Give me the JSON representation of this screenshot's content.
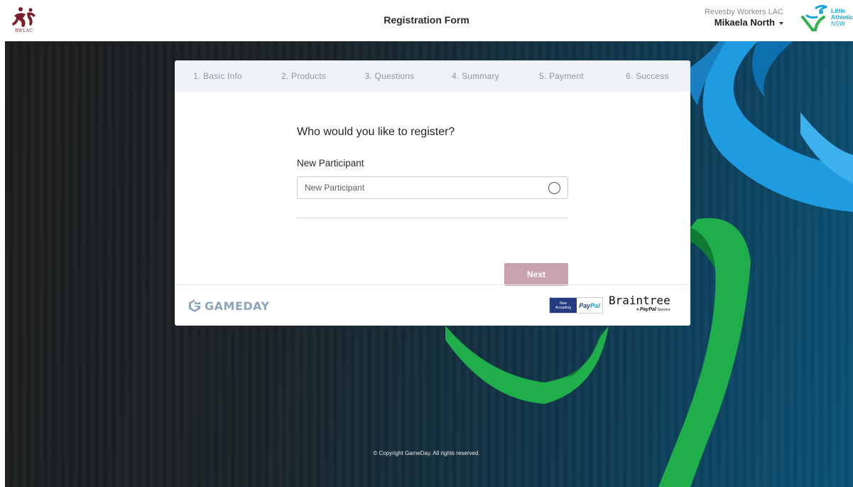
{
  "header": {
    "club_logo_text": "RWLAC",
    "title": "Registration Form",
    "org_name": "Revesby Workers LAC",
    "user_name": "Mikaela North",
    "partner_logo": {
      "line1": "Little",
      "line2": "Athletics",
      "line3": "NSW"
    }
  },
  "steps": [
    {
      "label": "1. Basic Info"
    },
    {
      "label": "2. Products"
    },
    {
      "label": "3. Questions"
    },
    {
      "label": "4. Summary"
    },
    {
      "label": "5. Payment"
    },
    {
      "label": "6. Success"
    }
  ],
  "form": {
    "question": "Who would you like to register?",
    "field_label": "New Participant",
    "select_value": "New Participant",
    "next_label": "Next"
  },
  "footer": {
    "gameday_text": "GAMEDAY",
    "paypal_now": "Now",
    "paypal_accepting": "Accepting",
    "paypal_pay": "Pay",
    "paypal_pal": "Pal",
    "braintree_name": "Braintree",
    "braintree_sub_a": "A",
    "braintree_sub_paypal": "PayPal",
    "braintree_sub_service": "Service",
    "copyright": "© Copyright GameDay. All rights reserved."
  },
  "colors": {
    "next_button": "#c8a3af",
    "steps_bar": "#eef2f7",
    "gameday": "#8ea5ba",
    "ribbon_blue": "#1f9be0",
    "ribbon_green": "#1fae4a",
    "club_brand": "#7a1f2b"
  },
  "icons": {
    "user_menu": "chevron-down-icon",
    "select_state": "radio-circle-icon",
    "gameday": "gameday-g-icon"
  }
}
